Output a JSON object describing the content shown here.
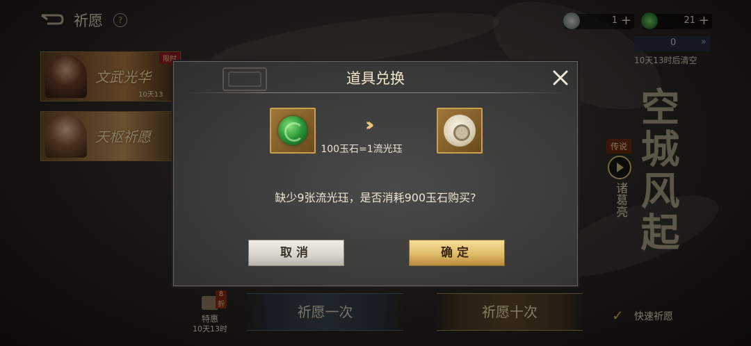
{
  "topbar": {
    "title": "祈愿",
    "help": "?",
    "currency_a": {
      "value": "1",
      "plus": "+",
      "color": "#9ba8a0"
    },
    "currency_b": {
      "value": "21",
      "plus": "+",
      "color": "#2e9a3a"
    },
    "counter": {
      "value": "0",
      "arrow": "»"
    },
    "clear_text": "10天13时后清空"
  },
  "banners": [
    {
      "name": "文武光华",
      "tag": "限时",
      "timer": "10天13"
    },
    {
      "name": "天枢祈愿"
    }
  ],
  "side": {
    "title": "空城风起",
    "legend_tag": "传说",
    "hero_name": "诸葛亮"
  },
  "bottom": {
    "gift_discount": "8折",
    "gift_label": "特惠",
    "gift_time": "10天13时",
    "pray_once": "祈愿一次",
    "pray_ten": "祈愿十次",
    "quick_check": "✓",
    "quick_label": "快速祈愿"
  },
  "modal": {
    "title": "道具兑换",
    "close_glyph": "✕",
    "item_from": "jade-stone-icon",
    "item_to": "jade-pendant-icon",
    "arrow": "»",
    "rate": "100玉石=1流光珏",
    "prompt": "缺少9张流光珏，是否消耗900玉石购买?",
    "cancel_label": "取消",
    "confirm_label": "确定"
  }
}
